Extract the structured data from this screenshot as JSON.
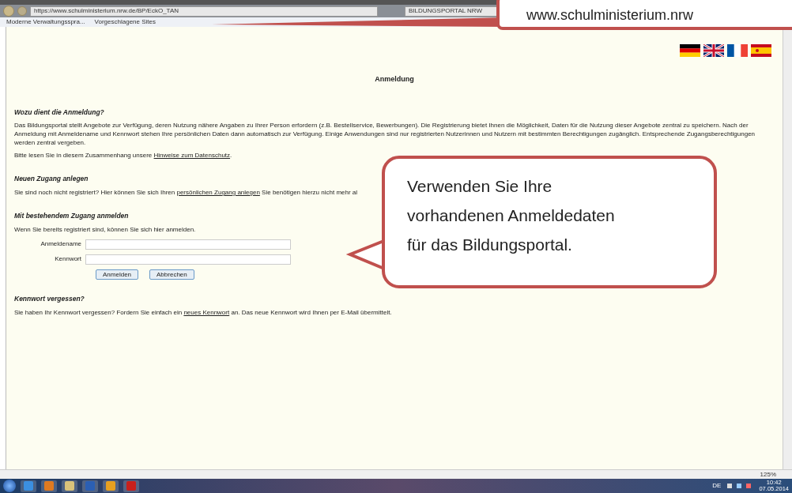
{
  "browser": {
    "address": "https://www.schulministerium.nrw.de/BP/EckO_TAN",
    "tab_title": "BILDUNGSPORTAL NRW",
    "favorites": [
      "Moderne Verwaltungsspra...",
      "Vorgeschlagene Sites"
    ]
  },
  "page": {
    "title": "Anmeldung",
    "sections": [
      {
        "heading": "Wozu dient die Anmeldung?",
        "paragraphs": [
          [
            {
              "text": "Das Bildungsportal stellt Angebote zur Verfügung, deren Nutzung nähere Angaben zu Ihrer Person erfordern (z.B. Bestellservice, Bewerbungen). Die Registrierung bietet Ihnen die Möglichkeit, Daten für die Nutzung dieser Angebote zentral zu speichern. Nach der Anmeldung mit Anmeldename und Kennwort stehen Ihre persönlichen Daten dann automatisch zur Verfügung. Einige Anwendungen sind nur registrierten Nutzerinnen und Nutzern mit bestimmten Berechtigungen zugänglich. Entsprechende Zugangsberechtigungen werden zentral vergeben.",
              "link": false
            }
          ],
          [
            {
              "text": "Bitte lesen Sie in diesem Zusammenhang unsere",
              "link": false
            },
            {
              "text": "Hinweise zum Datenschutz",
              "link": true
            },
            {
              "text": ".",
              "link": false
            }
          ]
        ]
      },
      {
        "heading": "Neuen Zugang anlegen",
        "paragraphs": [
          [
            {
              "text": "Sie sind noch nicht registriert? Hier können Sie sich Ihren",
              "link": false
            },
            {
              "text": "persönlichen Zugang anlegen",
              "link": true
            },
            {
              "text": "Sie benötigen hierzu nicht mehr al",
              "link": false
            }
          ]
        ]
      },
      {
        "heading": "Mit bestehendem Zugang anmelden",
        "paragraphs": [
          [
            {
              "text": "Wenn Sie bereits registriert sind, können Sie sich hier anmelden.",
              "link": false
            }
          ]
        ],
        "form": {
          "fields": [
            {
              "label": "Anmeldename"
            },
            {
              "label": "Kennwort"
            }
          ],
          "buttons": [
            "Anmelden",
            "Abbrechen"
          ]
        }
      },
      {
        "heading": "Kennwort vergessen?",
        "paragraphs": [
          [
            {
              "text": "Sie haben Ihr Kennwort vergessen? Fordern Sie einfach ein",
              "link": false
            },
            {
              "text": "neues Kennwort",
              "link": true
            },
            {
              "text": "an. Das neue Kennwort wird Ihnen per E-Mail übermittelt.",
              "link": false
            }
          ]
        ]
      }
    ]
  },
  "status_bar": {
    "zoom": "125%"
  },
  "taskbar": {
    "language": "DE",
    "time": "10:42",
    "date": "07.05.2014"
  },
  "callouts": [
    {
      "text": "www.schulministerium.nrw"
    },
    {
      "text": "Verwenden Sie Ihre vorhandenen Anmeldedaten für das Bildungsportal."
    }
  ]
}
